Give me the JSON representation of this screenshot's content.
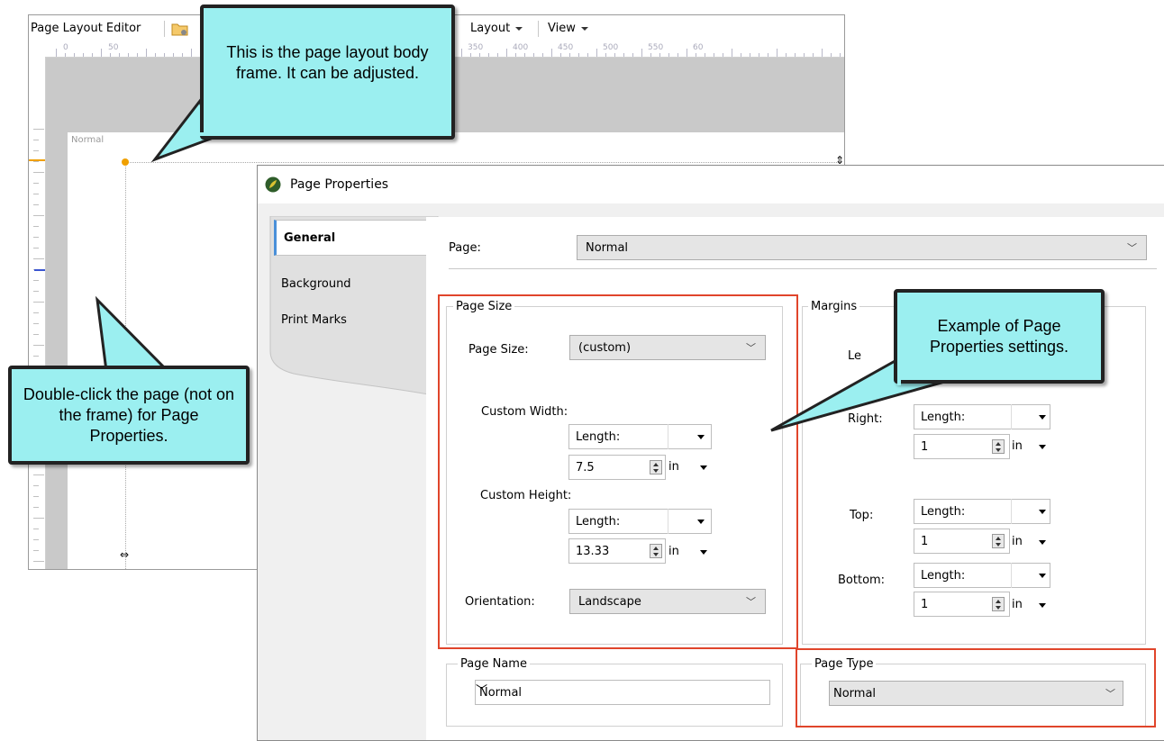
{
  "editor": {
    "title": "Page Layout Editor",
    "menu_layout": "Layout",
    "menu_view": "View",
    "ruler_labels": [
      "0",
      "50",
      "350",
      "400",
      "450",
      "500",
      "550",
      "60"
    ],
    "page_label": "Normal"
  },
  "dialog": {
    "title": "Page Properties",
    "tabs": [
      "General",
      "Background",
      "Print Marks"
    ],
    "page_label": "Page:",
    "page_value": "Normal",
    "page_size_group": "Page Size",
    "page_size_label": "Page Size:",
    "page_size_value": "(custom)",
    "custom_width_label": "Custom Width:",
    "custom_width_mode": "Length:",
    "custom_width_value": "7.5",
    "custom_width_unit": "in",
    "custom_height_label": "Custom Height:",
    "custom_height_mode": "Length:",
    "custom_height_value": "13.33",
    "custom_height_unit": "in",
    "orientation_label": "Orientation:",
    "orientation_value": "Landscape",
    "margins_group": "Margins",
    "margin_left_label_partial": "Le",
    "margins": {
      "right": {
        "label": "Right:",
        "mode": "Length:",
        "value": "1",
        "unit": "in"
      },
      "top": {
        "label": "Top:",
        "mode": "Length:",
        "value": "1",
        "unit": "in"
      },
      "bottom": {
        "label": "Bottom:",
        "mode": "Length:",
        "value": "1",
        "unit": "in"
      }
    },
    "page_name_group": "Page Name",
    "page_name_value": "Normal",
    "page_type_group": "Page Type",
    "page_type_value": "Normal"
  },
  "callouts": {
    "frame": "This is the page layout body frame. It can be adjusted.",
    "doubleclick": "Double-click the page (not on the frame) for Page Properties.",
    "example": "Example of Page Properties settings."
  },
  "colors": {
    "callout_fill": "#9beff0",
    "highlight_red": "#e0452b",
    "orange_marker": "#f0a000"
  }
}
